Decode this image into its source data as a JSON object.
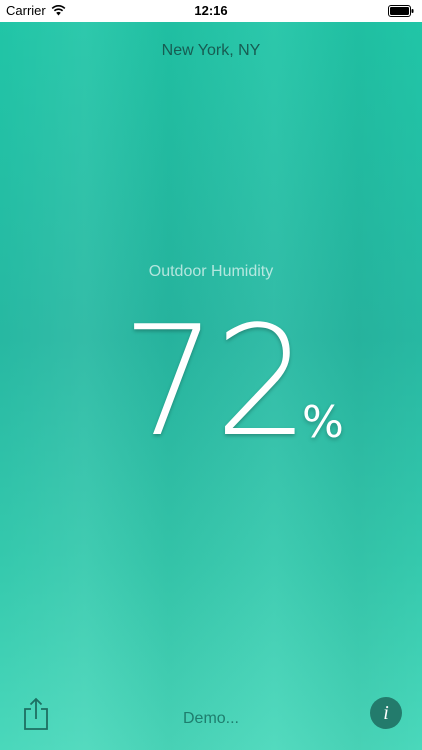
{
  "status_bar": {
    "carrier": "Carrier",
    "time": "12:16"
  },
  "location": "New York, NY",
  "metric": {
    "label": "Outdoor Humidity",
    "value": "72",
    "unit": "%"
  },
  "footer": {
    "status_text": "Demo...",
    "info_glyph": "i"
  },
  "colors": {
    "background_top": "#20c6a7",
    "background_bottom": "#4ad8bb",
    "location_text": "#175c52",
    "info_button": "#237b6c"
  },
  "icons": {
    "share": "share-icon",
    "info": "info-icon",
    "wifi": "wifi-icon",
    "battery": "battery-icon"
  }
}
